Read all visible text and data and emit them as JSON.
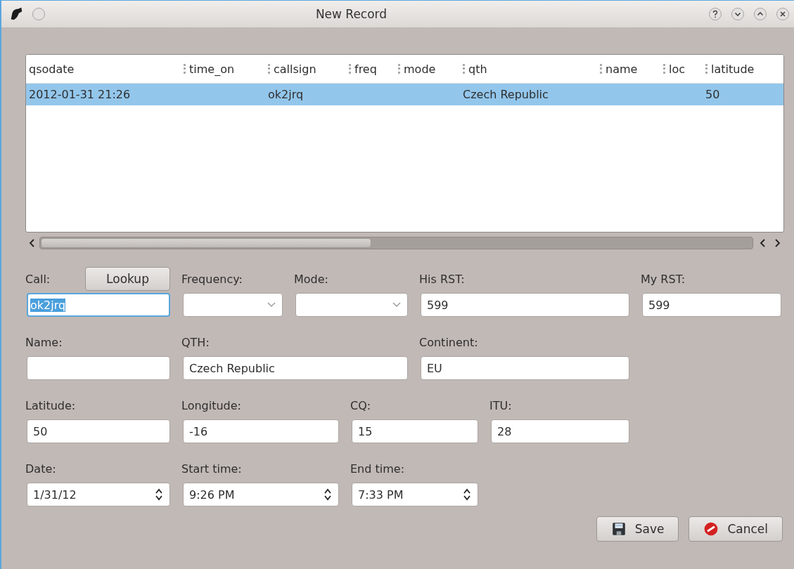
{
  "window": {
    "title": "New Record"
  },
  "table": {
    "columns": [
      "qsodate",
      "time_on",
      "callsign",
      "freq",
      "mode",
      "qth",
      "name",
      "loc",
      "latitude"
    ],
    "rows": [
      {
        "selected": true,
        "cells": [
          "2012-01-31 21:26",
          "",
          "ok2jrq",
          "",
          "",
          "Czech Republic",
          "",
          "",
          "50"
        ]
      }
    ]
  },
  "form": {
    "lookup_button": "Lookup",
    "rows": [
      [
        {
          "label": "Call:",
          "kind": "text",
          "value": "ok2jrq",
          "selected": true
        },
        {
          "label": "Frequency:",
          "kind": "combo"
        },
        {
          "label": "Mode:",
          "kind": "combo"
        },
        {
          "label": "His RST:",
          "kind": "text",
          "value": "599"
        },
        {
          "label": "My RST:",
          "kind": "text",
          "value": "599"
        }
      ],
      [
        {
          "label": "Name:",
          "kind": "text"
        },
        {
          "label": "QTH:",
          "kind": "text",
          "value": "Czech Republic"
        },
        {
          "label": "Continent:",
          "kind": "text",
          "value": "EU"
        }
      ],
      [
        {
          "label": "Latitude:",
          "kind": "text",
          "value": "50"
        },
        {
          "label": "Longitude:",
          "kind": "text",
          "value": "-16"
        },
        {
          "label": "CQ:",
          "kind": "text",
          "value": "15"
        },
        {
          "label": "ITU:",
          "kind": "text",
          "value": "28"
        }
      ],
      [
        {
          "label": "Date:",
          "kind": "spin",
          "value": "1/31/12"
        },
        {
          "label": "Start time:",
          "kind": "spin",
          "value": "9:26 PM"
        },
        {
          "label": "End time:",
          "kind": "spin",
          "value": "7:33 PM"
        }
      ]
    ]
  },
  "buttons": [
    {
      "kind": "save",
      "label": "Save"
    },
    {
      "kind": "cancel",
      "label": "Cancel"
    }
  ]
}
